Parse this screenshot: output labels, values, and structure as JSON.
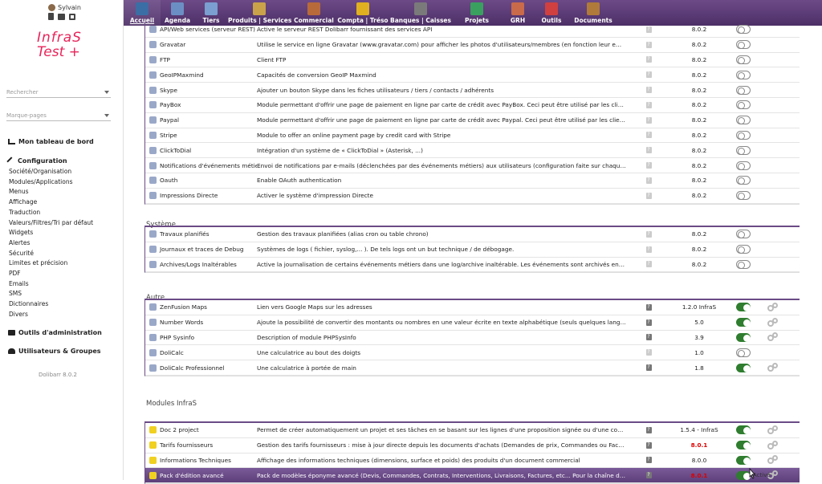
{
  "user": {
    "name": "Sylvain"
  },
  "logo": {
    "line1": "InfraS",
    "line2": "Test +"
  },
  "sidebar": {
    "search_placeholder": "Rechercher",
    "bookmarks_placeholder": "Marque-pages",
    "dashboard": "Mon tableau de bord",
    "config_title": "Configuration",
    "config_items": [
      "Société/Organisation",
      "Modules/Applications",
      "Menus",
      "Affichage",
      "Traduction",
      "Valeurs/Filtres/Tri par défaut",
      "Widgets",
      "Alertes",
      "Sécurité",
      "Limites et précision",
      "PDF",
      "Emails",
      "SMS",
      "Dictionnaires",
      "Divers"
    ],
    "admin_tools": "Outils d'administration",
    "users_groups": "Utilisateurs & Groupes",
    "version": "Dolibarr 8.0.2"
  },
  "topbar": {
    "tabs": [
      {
        "label": "Accueil",
        "color": "#3a6ea5"
      },
      {
        "label": "Agenda",
        "color": "#6b8fc4"
      },
      {
        "label": "Tiers",
        "color": "#7a9fd0"
      },
      {
        "label": "Produits | Services",
        "color": "#c9a24a"
      },
      {
        "label": "Commercial",
        "color": "#b86a3a"
      },
      {
        "label": "Compta | Tréso",
        "color": "#e0b020"
      },
      {
        "label": "Banques | Caisses",
        "color": "#7a7a7a"
      },
      {
        "label": "Projets",
        "color": "#3aa060"
      },
      {
        "label": "GRH",
        "color": "#c96a4a"
      },
      {
        "label": "Outils",
        "color": "#d04040"
      },
      {
        "label": "Documents",
        "color": "#b07a3a"
      }
    ]
  },
  "sections": [
    {
      "title": "",
      "rows": [
        {
          "icon": "api-icon",
          "name": "API/Web services (serveur REST)",
          "desc": "Active le serveur REST Dolibarr fournissant des services API",
          "version": "8.0.2",
          "on": false,
          "gear": false
        },
        {
          "icon": "gravatar-icon",
          "name": "Gravatar",
          "desc": "Utilise le service en ligne Gravatar (www.gravatar.com) pour afficher les photos d'utilisateurs/membres (en fonction leur email). Be...",
          "version": "8.0.2",
          "on": false,
          "gear": false
        },
        {
          "icon": "ftp-icon",
          "name": "FTP",
          "desc": "Client FTP",
          "version": "8.0.2",
          "on": false,
          "gear": false
        },
        {
          "icon": "geoip-icon",
          "name": "GeoIPMaxmind",
          "desc": "Capacités de conversion GeoIP Maxmind",
          "version": "8.0.2",
          "on": false,
          "gear": false
        },
        {
          "icon": "skype-icon",
          "name": "Skype",
          "desc": "Ajouter un bouton Skype dans les fiches utilisateurs / tiers / contacts / adhérents",
          "version": "8.0.2",
          "on": false,
          "gear": false
        },
        {
          "icon": "paybox-icon",
          "name": "PayBox",
          "desc": "Module permettant d'offrir une page de paiement en ligne par carte de crédit avec PayBox. Ceci peut être utilisé par les clients pour ...",
          "version": "8.0.2",
          "on": false,
          "gear": false
        },
        {
          "icon": "paypal-icon",
          "name": "Paypal",
          "desc": "Module permettant d'offrir une page de paiement en ligne par carte de crédit avec Paypal. Ceci peut être utilisé par les clients pour f...",
          "version": "8.0.2",
          "on": false,
          "gear": false
        },
        {
          "icon": "stripe-icon",
          "name": "Stripe",
          "desc": "Module to offer an online payment page by credit card with Stripe",
          "version": "8.0.2",
          "on": false,
          "gear": false
        },
        {
          "icon": "phone-icon",
          "name": "ClickToDial",
          "desc": "Intégration d'un système de « ClickToDial » (Asterisk, ...)",
          "version": "8.0.2",
          "on": false,
          "gear": false
        },
        {
          "icon": "notification-icon",
          "name": "Notifications d'événements métiers",
          "desc": "Envoi de notifications par e-mails (déclenchées par des événements métiers) aux utilisateurs (configuration faite sur chaque fiche u...",
          "version": "8.0.2",
          "on": false,
          "gear": false
        },
        {
          "icon": "oauth-icon",
          "name": "Oauth",
          "desc": "Enable OAuth authentication",
          "version": "8.0.2",
          "on": false,
          "gear": false
        },
        {
          "icon": "printer-icon",
          "name": "Impressions Directe",
          "desc": "Activer le système d'impression Directe",
          "version": "8.0.2",
          "on": false,
          "gear": false
        }
      ]
    },
    {
      "title": "Système",
      "rows": [
        {
          "icon": "cron-icon",
          "name": "Travaux planifiés",
          "desc": "Gestion des travaux planifiées (alias cron ou table chrono)",
          "version": "8.0.2",
          "on": false,
          "gear": false
        },
        {
          "icon": "debug-icon",
          "name": "Journaux et traces de Debug",
          "desc": "Systèmes de logs ( fichier, syslog,... ). De tels logs ont un but technique / de débogage.",
          "version": "8.0.2",
          "on": false,
          "gear": false
        },
        {
          "icon": "archive-icon",
          "name": "Archives/Logs Inaltérables",
          "desc": "Active la journalisation de certains événements métiers dans une log/archive inaltérable. Les événements sont archivés en temps ré...",
          "version": "8.0.2",
          "on": false,
          "gear": false
        }
      ]
    },
    {
      "title": "Autre",
      "rows": [
        {
          "icon": "map-icon",
          "name": "ZenFusion Maps",
          "desc": "Lien vers Google Maps sur les adresses",
          "version": "1.2.0 InfraS",
          "on": true,
          "gear": true
        },
        {
          "icon": "numberwords-icon",
          "name": "Number Words",
          "desc": "Ajoute la possibilité de convertir des montants ou nombres en une valeur écrite en texte alphabétique (seuls quelques languages so...",
          "version": "5.0",
          "on": true,
          "gear": true
        },
        {
          "icon": "php-icon",
          "name": "PHP Sysinfo",
          "desc": "Description of module PHPSysInfo",
          "version": "3.9",
          "on": true,
          "gear": true
        },
        {
          "icon": "calculator-icon",
          "name": "DoliCalc",
          "desc": "Une calculatrice au bout des doigts",
          "version": "1.0",
          "on": false,
          "gear": false
        },
        {
          "icon": "calculator-icon",
          "name": "DoliCalc Professionnel",
          "desc": "Une calculatrice à portée de main",
          "version": "1.8",
          "on": true,
          "gear": true
        }
      ]
    },
    {
      "title": "Modules InfraS",
      "rows": [
        {
          "icon": "infras-icon",
          "name": "Doc 2 project",
          "desc": "Permet de créer automatiquement un projet et ses tâches en se basant sur les lignes d'une proposition signée ou d'une commande c...",
          "version": "1.5.4 - InfraS",
          "red": false,
          "on": true,
          "gear": true
        },
        {
          "icon": "infras-icon",
          "name": "Tarifs fournisseurs",
          "desc": "Gestion des tarifs fournisseurs : mise à jour directe depuis les documents d'achats (Demandes de prix, Commandes ou Factures)",
          "version": "8.0.1",
          "red": true,
          "on": true,
          "gear": true
        },
        {
          "icon": "infras-icon",
          "name": "Informations Techniques",
          "desc": "Affichage des informations techniques (dimensions, surface et poids) des produits d'un document commercial",
          "version": "8.0.0",
          "red": false,
          "on": true,
          "gear": true
        },
        {
          "icon": "infras-icon",
          "name": "Pack d'édition avancé",
          "desc": "Pack de modèles éponyme avancé (Devis, Commandes, Contrats, Interventions, Livraisons, Factures, etc... Pour la chaîne des ventes ...",
          "version": "8.0.1",
          "red": true,
          "on": true,
          "gear": true,
          "highlight": true
        }
      ]
    }
  ],
  "tooltip": "Activé"
}
